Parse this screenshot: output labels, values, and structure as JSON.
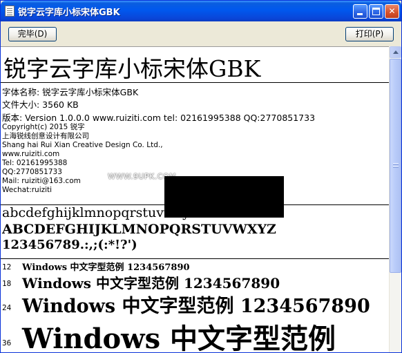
{
  "window": {
    "title": "锐字云字库小标宋体GBK",
    "minimize_glyph": "",
    "maximize_glyph": "",
    "close_glyph": "✕"
  },
  "toolbar": {
    "done_label": "完毕(D)",
    "print_label": "打印(P)"
  },
  "preview": {
    "font_name_large": "锐字云字库小标宋体GBK",
    "info": {
      "name_line": "字体名称: 锐字云字库小标宋体GBK",
      "size_line": "文件大小: 3560 KB",
      "version_line": "版本: Version 1.0.0.0 www.ruiziti.com tel: 02161995388 QQ:2770851733"
    },
    "copyright_lines": [
      "Copyright(c) 2015 锐字",
      "上海锐线创意设计有限公司",
      "Shang hai Rui Xian Creative Design Co. Ltd.,",
      "www.ruiziti.com",
      "Tel: 02161995388",
      "QQ:2770851733",
      "Mail: ruiziti@163.com",
      "Wechat:ruiziti"
    ],
    "watermark": "WWW.9UPK.COM",
    "sample_lowercase": "abcdefghijklmnopqrstuvwxyz",
    "sample_uppercase": "ABCDEFGHIJKLMNOPQRSTUVWXYZ",
    "sample_digits": "123456789.:,;(:*!?')",
    "size_samples": [
      {
        "size_label": "12",
        "text": "Windows 中文字型范例 1234567890"
      },
      {
        "size_label": "18",
        "text": "Windows 中文字型范例 1234567890"
      },
      {
        "size_label": "24",
        "text": "Windows 中文字型范例 1234567890"
      },
      {
        "size_label": "36",
        "text": "Windows 中文字型范例"
      }
    ]
  },
  "colors": {
    "titlebar": "#0058ee",
    "window_border": "#0831d9",
    "close_button": "#d6502a",
    "face": "#ece9d8"
  }
}
